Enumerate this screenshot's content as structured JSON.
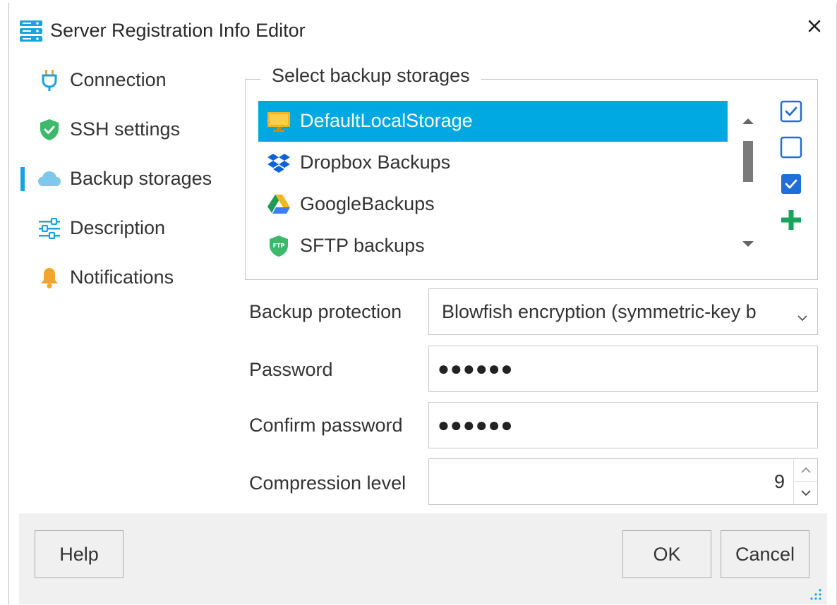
{
  "window": {
    "title": "Server Registration Info Editor",
    "app_icon": "server-stack-icon",
    "close_icon": "close-icon"
  },
  "sidebar": {
    "active_index": 2,
    "items": [
      {
        "label": "Connection",
        "icon": "plug-icon"
      },
      {
        "label": "SSH settings",
        "icon": "shield-check-icon"
      },
      {
        "label": "Backup storages",
        "icon": "cloud-icon"
      },
      {
        "label": "Description",
        "icon": "sliders-icon"
      },
      {
        "label": "Notifications",
        "icon": "bell-icon"
      }
    ]
  },
  "storages": {
    "group_title": "Select backup storages",
    "selected_index": 0,
    "items": [
      {
        "label": "DefaultLocalStorage",
        "icon": "monitor-icon"
      },
      {
        "label": "Dropbox Backups",
        "icon": "dropbox-icon"
      },
      {
        "label": "GoogleBackups",
        "icon": "google-drive-icon"
      },
      {
        "label": "SFTP backups",
        "icon": "sftp-shield-icon"
      }
    ],
    "checkboxes": [
      true,
      false,
      true
    ],
    "add_icon": "plus-icon"
  },
  "form": {
    "protection": {
      "label": "Backup protection",
      "value": "Blowfish encryption (symmetric-key b"
    },
    "password": {
      "label": "Password",
      "value": "●●●●●●"
    },
    "confirm": {
      "label": "Confirm password",
      "value": "●●●●●●"
    },
    "compression": {
      "label": "Compression level",
      "value": "9"
    }
  },
  "footer": {
    "help_label": "Help",
    "ok_label": "OK",
    "cancel_label": "Cancel"
  },
  "colors": {
    "accent": "#1aa3dc",
    "selection": "#00a8e1",
    "checkbox": "#1e6fd9",
    "add_green": "#1aa35a"
  }
}
